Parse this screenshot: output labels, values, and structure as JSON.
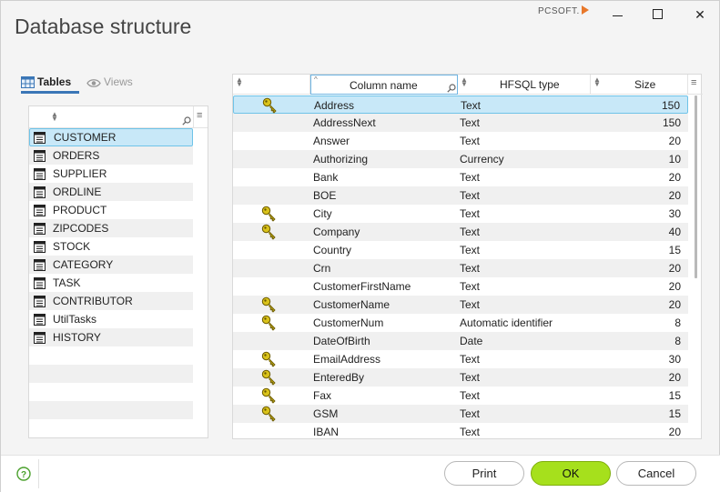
{
  "window": {
    "title": "Database structure",
    "brand": "PCSOFT.",
    "controls": [
      "minimize",
      "maximize",
      "close"
    ]
  },
  "tabs": [
    {
      "label": "Tables",
      "icon": "table-icon",
      "active": true
    },
    {
      "label": "Views",
      "icon": "eye-icon",
      "active": false
    }
  ],
  "tables": [
    {
      "label": "CUSTOMER",
      "selected": true
    },
    {
      "label": "ORDERS"
    },
    {
      "label": "SUPPLIER"
    },
    {
      "label": "ORDLINE"
    },
    {
      "label": "PRODUCT"
    },
    {
      "label": "ZIPCODES"
    },
    {
      "label": "STOCK"
    },
    {
      "label": "CATEGORY"
    },
    {
      "label": "TASK"
    },
    {
      "label": "CONTRIBUTOR"
    },
    {
      "label": "UtilTasks"
    },
    {
      "label": "HISTORY"
    }
  ],
  "grid": {
    "headers": {
      "column_name": "Column name",
      "type": "HFSQL type",
      "size": "Size"
    },
    "rows": [
      {
        "key": true,
        "name": "Address",
        "type": "Text",
        "size": "150",
        "selected": true
      },
      {
        "key": false,
        "name": "AddressNext",
        "type": "Text",
        "size": "150"
      },
      {
        "key": false,
        "name": "Answer",
        "type": "Text",
        "size": "20"
      },
      {
        "key": false,
        "name": "Authorizing",
        "type": "Currency",
        "size": "10"
      },
      {
        "key": false,
        "name": "Bank",
        "type": "Text",
        "size": "20"
      },
      {
        "key": false,
        "name": "BOE",
        "type": "Text",
        "size": "20"
      },
      {
        "key": true,
        "name": "City",
        "type": "Text",
        "size": "30"
      },
      {
        "key": true,
        "name": "Company",
        "type": "Text",
        "size": "40"
      },
      {
        "key": false,
        "name": "Country",
        "type": "Text",
        "size": "15"
      },
      {
        "key": false,
        "name": "Crn",
        "type": "Text",
        "size": "20"
      },
      {
        "key": false,
        "name": "CustomerFirstName",
        "type": "Text",
        "size": "20"
      },
      {
        "key": true,
        "name": "CustomerName",
        "type": "Text",
        "size": "20"
      },
      {
        "key": true,
        "name": "CustomerNum",
        "type": "Automatic identifier",
        "size": "8"
      },
      {
        "key": false,
        "name": "DateOfBirth",
        "type": "Date",
        "size": "8"
      },
      {
        "key": true,
        "name": "EmailAddress",
        "type": "Text",
        "size": "30"
      },
      {
        "key": true,
        "name": "EnteredBy",
        "type": "Text",
        "size": "20"
      },
      {
        "key": true,
        "name": "Fax",
        "type": "Text",
        "size": "15"
      },
      {
        "key": true,
        "name": "GSM",
        "type": "Text",
        "size": "15"
      },
      {
        "key": false,
        "name": "IBAN",
        "type": "Text",
        "size": "20"
      }
    ]
  },
  "footer": {
    "print_label": "Print",
    "ok_label": "OK",
    "cancel_label": "Cancel"
  },
  "colors": {
    "selection": "#c8e8f8",
    "selection_border": "#6fc3e8",
    "ok_button": "#a6e01c",
    "tab_underline": "#3a76b6",
    "key_icon": "#d9c21a"
  }
}
